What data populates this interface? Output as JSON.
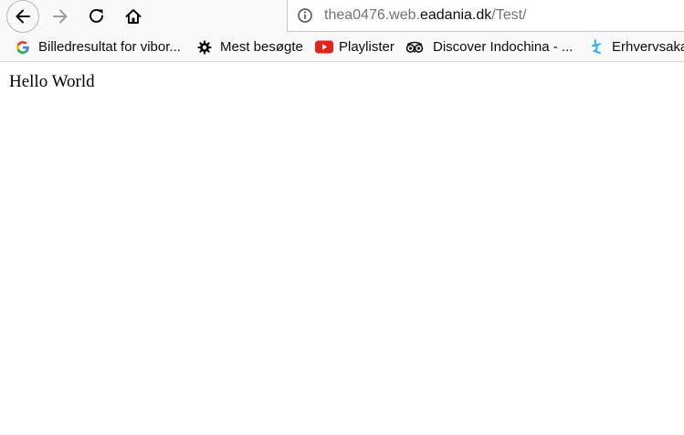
{
  "toolbar": {
    "back_icon": "arrow-left-icon",
    "forward_icon": "arrow-right-icon",
    "reload_icon": "reload-icon",
    "home_icon": "home-icon"
  },
  "urlbar": {
    "prefix": "thea0476.web.",
    "domain": "eadania.dk",
    "path": "/Test/",
    "info_icon": "info-icon"
  },
  "bookmarks": [
    {
      "label": "Billedresultat for vibor...",
      "icon": "google-icon"
    },
    {
      "label": "Mest besøgte",
      "icon": "gear-icon"
    },
    {
      "label": "Playlister",
      "icon": "youtube-icon"
    },
    {
      "label": "Discover Indochina - ...",
      "icon": "tripadvisor-icon"
    },
    {
      "label": "Erhvervsakad",
      "icon": "erhvervsakademi-icon"
    }
  ],
  "page": {
    "body_text": "Hello World"
  },
  "colors": {
    "toolbar_bg": "#f9f9fa",
    "url_dim": "#737373",
    "url_domain": "#0c0c0d",
    "youtube_red": "#e62117",
    "erhvervs_cyan": "#22b8e6"
  }
}
